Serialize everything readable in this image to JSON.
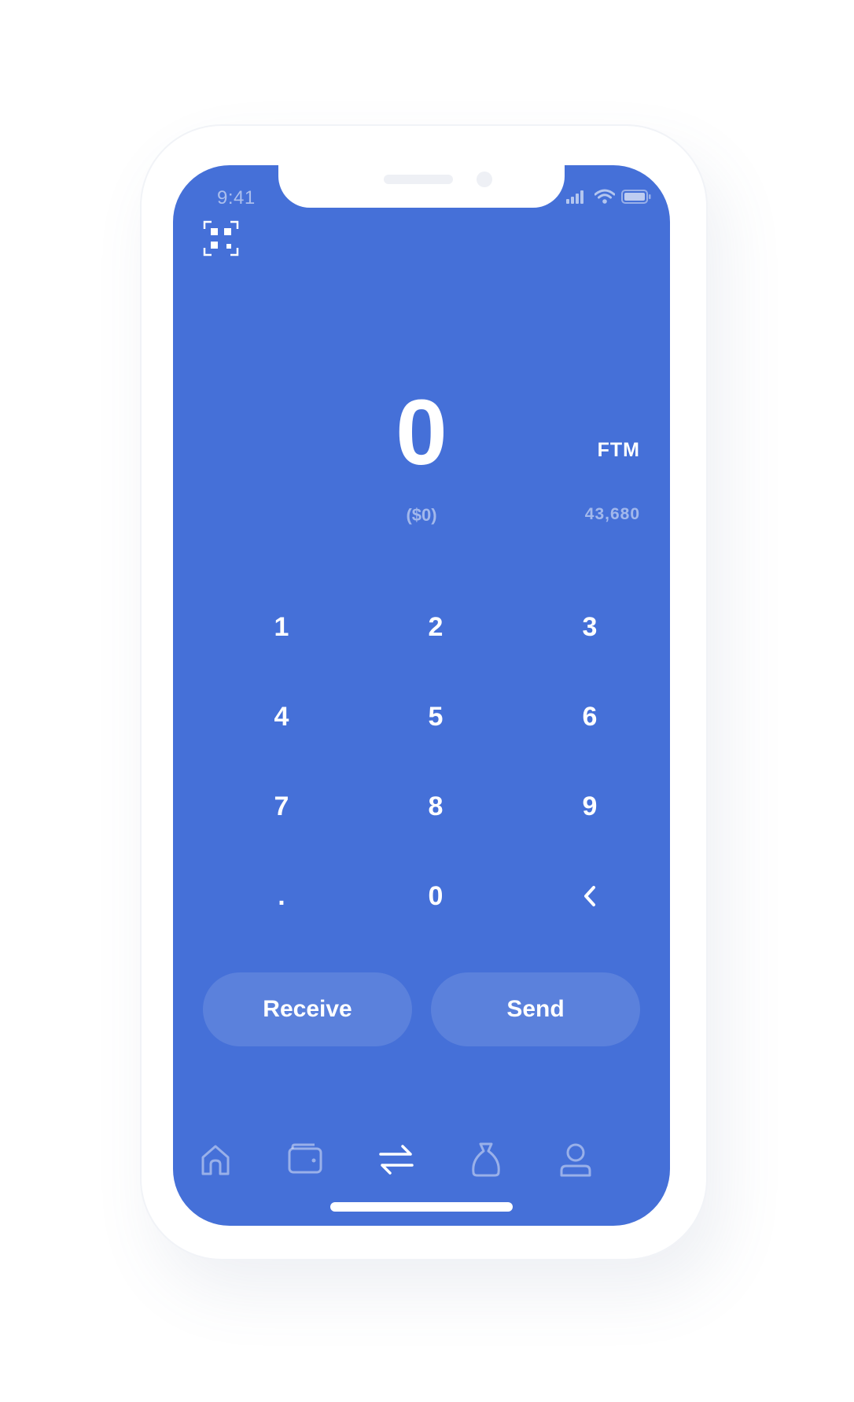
{
  "colors": {
    "accent": "#4570d8",
    "text": "#ffffff",
    "muted": "rgba(255,255,255,0.5)"
  },
  "status_bar": {
    "time": "9:41",
    "icons": [
      "signal-icon",
      "wifi-icon",
      "battery-icon"
    ]
  },
  "header": {
    "scan_icon": "qr-scan-icon"
  },
  "amount": {
    "value": "0",
    "unit": "FTM",
    "fiat": "($0)",
    "balance": "43,680"
  },
  "keypad": {
    "keys": [
      "1",
      "2",
      "3",
      "4",
      "5",
      "6",
      "7",
      "8",
      "9",
      ".",
      "0",
      "‹"
    ]
  },
  "actions": {
    "receive_label": "Receive",
    "send_label": "Send"
  },
  "tabbar": {
    "tabs": [
      {
        "icon": "home-icon",
        "active": false
      },
      {
        "icon": "wallet-icon",
        "active": false
      },
      {
        "icon": "transfer-icon",
        "active": true
      },
      {
        "icon": "money-bag-icon",
        "active": false
      },
      {
        "icon": "profile-icon",
        "active": false
      }
    ]
  }
}
